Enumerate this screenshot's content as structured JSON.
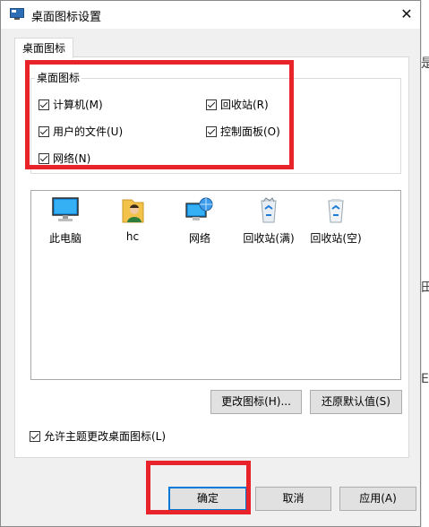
{
  "window": {
    "title": "桌面图标设置",
    "close_glyph": "✕"
  },
  "tab": {
    "label": "桌面图标"
  },
  "group": {
    "title": "桌面图标",
    "checkboxes": [
      {
        "label": "计算机(M)",
        "checked": true
      },
      {
        "label": "回收站(R)",
        "checked": true
      },
      {
        "label": "用户的文件(U)",
        "checked": true
      },
      {
        "label": "控制面板(O)",
        "checked": true
      },
      {
        "label": "网络(N)",
        "checked": true
      }
    ]
  },
  "icons": [
    {
      "label": "此电脑",
      "icon": "computer-icon"
    },
    {
      "label": "hc",
      "icon": "user-folder-icon"
    },
    {
      "label": "网络",
      "icon": "network-icon"
    },
    {
      "label": "回收站(满)",
      "icon": "recycle-bin-full-icon"
    },
    {
      "label": "回收站(空)",
      "icon": "recycle-bin-empty-icon"
    }
  ],
  "buttons": {
    "change_icon": "更改图标(H)...",
    "restore_default": "还原默认值(S)",
    "ok": "确定",
    "cancel": "取消",
    "apply": "应用(A)"
  },
  "allow_themes": {
    "label": "允许主题更改桌面图标(L)",
    "checked": true
  },
  "colors": {
    "highlight": "#e8232a",
    "accent": "#0078d7"
  },
  "background_fragments": [
    "是",
    "田",
    "已",
    "二",
    "E",
    "\\"
  ]
}
